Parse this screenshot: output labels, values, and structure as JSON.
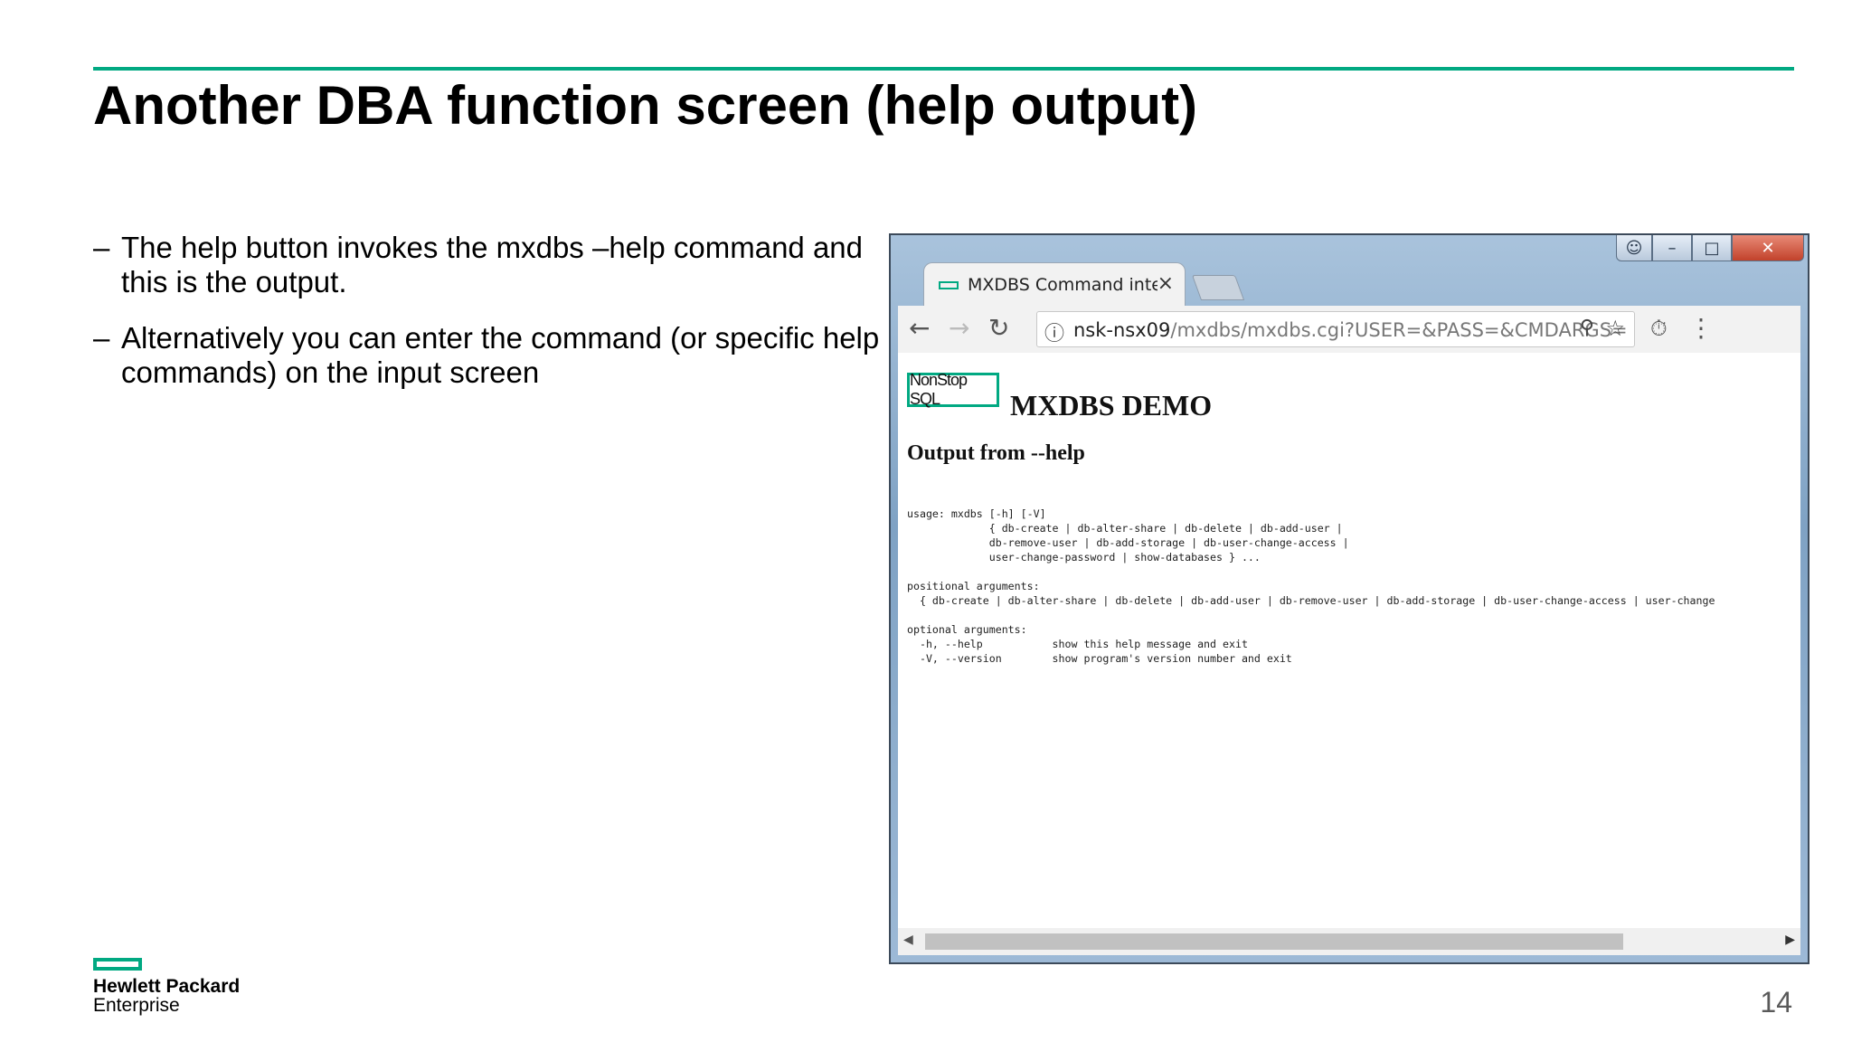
{
  "slide": {
    "title": "Another DBA function screen (help output)",
    "bullets": [
      "The help button invokes the mxdbs –help command and this is the output.",
      "Alternatively you can enter the command (or specific help commands) on the input screen"
    ],
    "bullet_marker": "–",
    "page_number": "14",
    "brand": {
      "name": "Hewlett Packard",
      "sub": "Enterprise",
      "accent": "#01a982"
    }
  },
  "browser": {
    "tab_title": "MXDBS Command interfa",
    "tab_close": "×",
    "url_host": "nsk-nsx09",
    "url_path": "/mxdbs/mxdbs.cgi?USER=&PASS=&CMDARGS=",
    "icons": [
      "back-arrow-icon",
      "forward-arrow-icon",
      "reload-icon",
      "info-icon",
      "zoom-icon",
      "star-icon",
      "performance-icon",
      "menu-icon"
    ],
    "window_controls": {
      "user": "☺",
      "min": "–",
      "max": "□",
      "close": "✕"
    }
  },
  "page": {
    "logo_text": "NonStop SQL",
    "heading": "MXDBS DEMO",
    "output_heading": "Output from --help",
    "help_text": "usage: mxdbs [-h] [-V]\n             { db-create | db-alter-share | db-delete | db-add-user |\n             db-remove-user | db-add-storage | db-user-change-access |\n             user-change-password | show-databases } ...\n\npositional arguments:\n  { db-create | db-alter-share | db-delete | db-add-user | db-remove-user | db-add-storage | db-user-change-access | user-change\n\noptional arguments:\n  -h, --help           show this help message and exit\n  -V, --version        show program's version number and exit"
  }
}
